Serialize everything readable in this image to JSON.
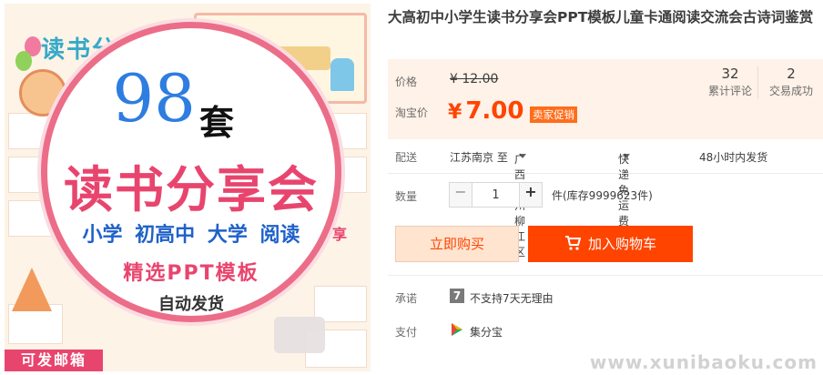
{
  "image": {
    "brand_text": "读书分享会",
    "count_number": "98",
    "count_unit": "套",
    "hero_title": "读书分享会",
    "levels": "小学 初高中 大学 阅读",
    "template_line": "精选PPT模板",
    "auto_line": "自动发货",
    "mail_badge": "可发邮箱",
    "side_text": "享"
  },
  "product": {
    "title": "大高初中小学生读书分享会PPT模板儿童卡通阅读交流会古诗词鉴赏"
  },
  "price": {
    "orig_label": "价格",
    "orig_value": "¥ 12.00",
    "promo_label": "淘宝价",
    "promo_currency": "¥",
    "promo_value": "7.00",
    "promo_tag": "卖家促销"
  },
  "stats": {
    "reviews_count": "32",
    "reviews_label": "累计评论",
    "sales_count": "2",
    "sales_label": "交易成功"
  },
  "shipping": {
    "label": "配送",
    "from": "江苏南京 至",
    "to": "广西柳州柳江区",
    "method": "快递 免运费",
    "dispatch": "48小时内发货"
  },
  "quantity": {
    "label": "数量",
    "minus": "−",
    "value": "1",
    "plus": "+",
    "stock": "件(库存9999623件)"
  },
  "actions": {
    "buy_now": "立即购买",
    "add_to_cart": "加入购物车"
  },
  "promise": {
    "label": "承诺",
    "icon_text": "7",
    "value": "不支持7天无理由"
  },
  "payment": {
    "label": "支付",
    "value": "集分宝"
  },
  "watermark": "www.xunibaoku.com",
  "colors": {
    "accent": "#ff4400",
    "price_bg": "#fff2e8",
    "hero_pink": "#e8456e",
    "hero_blue": "#2e7de0"
  }
}
